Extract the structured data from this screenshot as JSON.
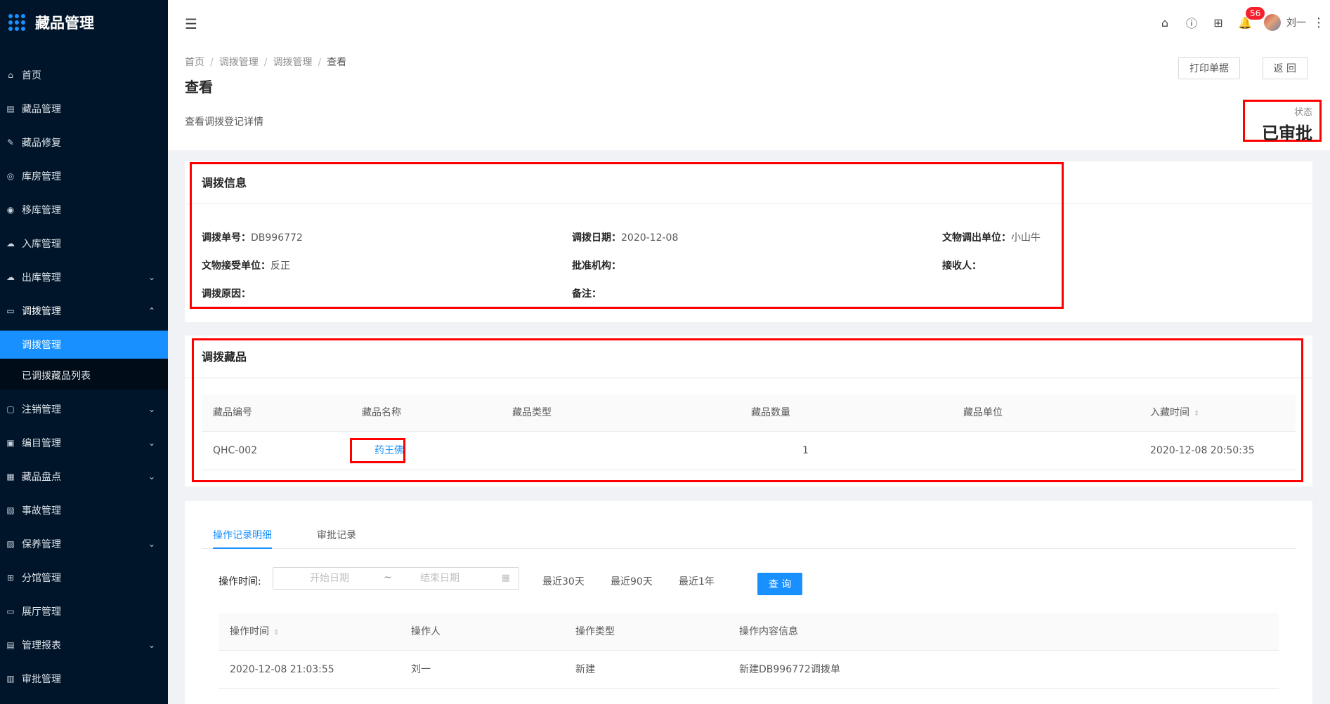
{
  "app": {
    "title": "藏品管理"
  },
  "sidebar": {
    "items": [
      {
        "label": "首页",
        "icon": "home-icon",
        "glyph": "⌂"
      },
      {
        "label": "藏品管理",
        "icon": "calendar-icon",
        "glyph": "▤"
      },
      {
        "label": "藏品修复",
        "icon": "wrench-icon",
        "glyph": "✎"
      },
      {
        "label": "库房管理",
        "icon": "warehouse-icon",
        "glyph": "◎"
      },
      {
        "label": "移库管理",
        "icon": "move-icon",
        "glyph": "◉"
      },
      {
        "label": "入库管理",
        "icon": "cloud-upload-icon",
        "glyph": "☁"
      },
      {
        "label": "出库管理",
        "icon": "cloud-download-icon",
        "glyph": "☁"
      },
      {
        "label": "调拨管理",
        "icon": "transfer-icon",
        "glyph": "▭"
      }
    ],
    "sub_items": [
      {
        "label": "调拨管理"
      },
      {
        "label": "已调拨藏品列表"
      }
    ],
    "items_after": [
      {
        "label": "注销管理",
        "icon": "file-icon",
        "glyph": "▢"
      },
      {
        "label": "编目管理",
        "icon": "catalog-icon",
        "glyph": "▣"
      },
      {
        "label": "藏品盘点",
        "icon": "inventory-icon",
        "glyph": "▦"
      },
      {
        "label": "事故管理",
        "icon": "accident-icon",
        "glyph": "▧"
      },
      {
        "label": "保养管理",
        "icon": "maintenance-icon",
        "glyph": "▨"
      },
      {
        "label": "分馆管理",
        "icon": "branch-icon",
        "glyph": "⊞"
      },
      {
        "label": "展厅管理",
        "icon": "hall-icon",
        "glyph": "▭"
      },
      {
        "label": "管理报表",
        "icon": "report-icon",
        "glyph": "▤"
      },
      {
        "label": "审批管理",
        "icon": "approval-icon",
        "glyph": "▥"
      }
    ]
  },
  "header": {
    "notification_count": "56",
    "user_name": "刘一"
  },
  "page": {
    "breadcrumb": [
      "首页",
      "调拨管理",
      "调拨管理",
      "查看"
    ],
    "title": "查看",
    "description": "查看调拨登记详情",
    "print_button": "打印单据",
    "back_button": "返 回",
    "status_label": "状态",
    "status_value": "已审批"
  },
  "transfer_info": {
    "title": "调拨信息",
    "fields": [
      {
        "key": "调拨单号：",
        "value": "DB996772"
      },
      {
        "key": "调拨日期：",
        "value": "2020-12-08"
      },
      {
        "key": "文物调出单位：",
        "value": "小山牛"
      },
      {
        "key": "文物接受单位：",
        "value": "反正"
      },
      {
        "key": "批准机构：",
        "value": ""
      },
      {
        "key": "接收人：",
        "value": ""
      },
      {
        "key": "调拨原因：",
        "value": ""
      },
      {
        "key": "备注：",
        "value": ""
      }
    ]
  },
  "transfer_items": {
    "title": "调拨藏品",
    "columns": [
      "藏品编号",
      "藏品名称",
      "藏品类型",
      "藏品数量",
      "藏品单位",
      "入藏时间"
    ],
    "rows": [
      {
        "code": "QHC-002",
        "name": "药王佛",
        "type": "",
        "quantity": "1",
        "unit": "",
        "time": "2020-12-08 20:50:35"
      }
    ]
  },
  "records": {
    "tabs": [
      "操作记录明细",
      "审批记录"
    ],
    "filter_label": "操作时间:",
    "start_placeholder": "开始日期",
    "end_placeholder": "结束日期",
    "range_separator": "~",
    "quick_ranges": [
      "最近30天",
      "最近90天",
      "最近1年"
    ],
    "query_button": "查 询",
    "columns": [
      "操作时间",
      "操作人",
      "操作类型",
      "操作内容信息"
    ],
    "rows": [
      {
        "time": "2020-12-08 21:03:55",
        "operator": "刘一",
        "type": "新建",
        "content": "新建DB996772调拨单"
      }
    ]
  },
  "colors": {
    "sidebar_bg": "#001529",
    "accent": "#1890ff",
    "highlight": "#ff0000",
    "badge": "#f5222d"
  }
}
